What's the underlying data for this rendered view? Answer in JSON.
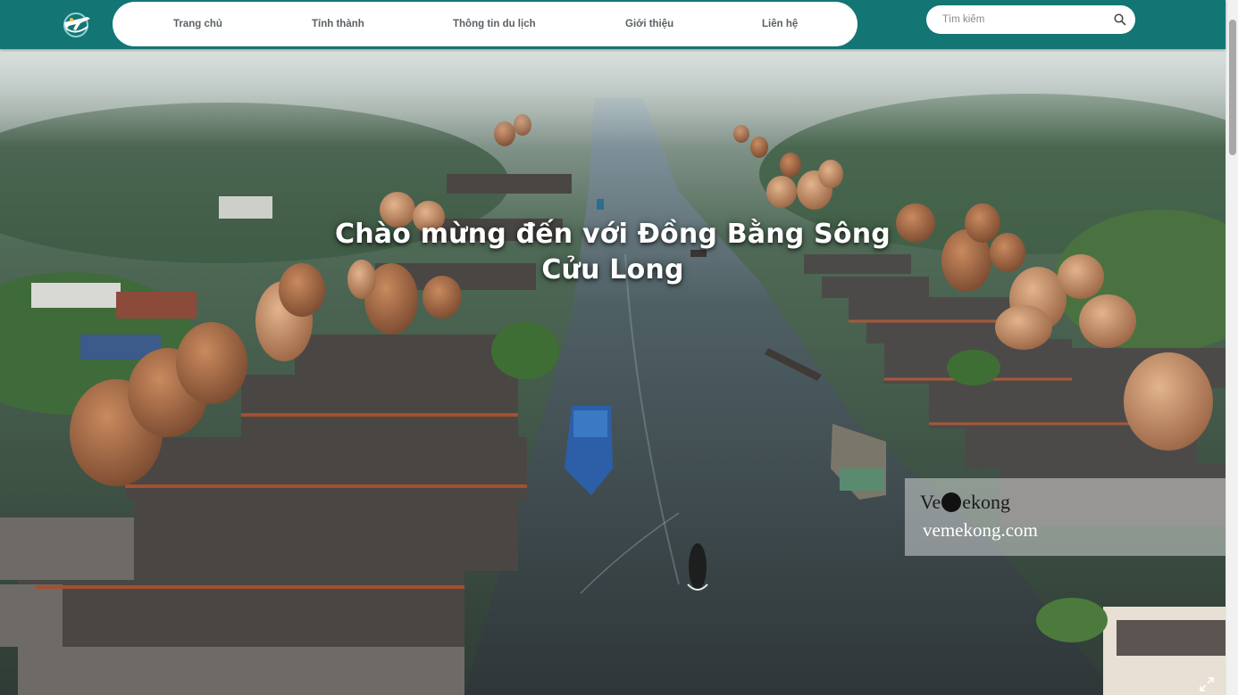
{
  "nav": {
    "items": [
      {
        "label": "Trang chủ"
      },
      {
        "label": "Tỉnh thành"
      },
      {
        "label": "Thông tin du lịch"
      },
      {
        "label": "Giới thiệu"
      },
      {
        "label": "Liên hệ"
      }
    ]
  },
  "search": {
    "placeholder": "Tìm kiếm"
  },
  "hero": {
    "title_line1": "Chào mừng đến với Đồng Bằng Sông",
    "title_line2": "Cửu Long"
  },
  "watermark": {
    "brand_prefix": "Ve",
    "brand_suffix": "ekong",
    "url": "vemekong.com"
  },
  "icons": {
    "logo": "plane-globe-logo-icon",
    "search": "search-icon",
    "expand": "expand-icon"
  },
  "colors": {
    "header_bg": "#137574",
    "nav_text": "#5b6165",
    "nav_bg": "#ffffff"
  }
}
